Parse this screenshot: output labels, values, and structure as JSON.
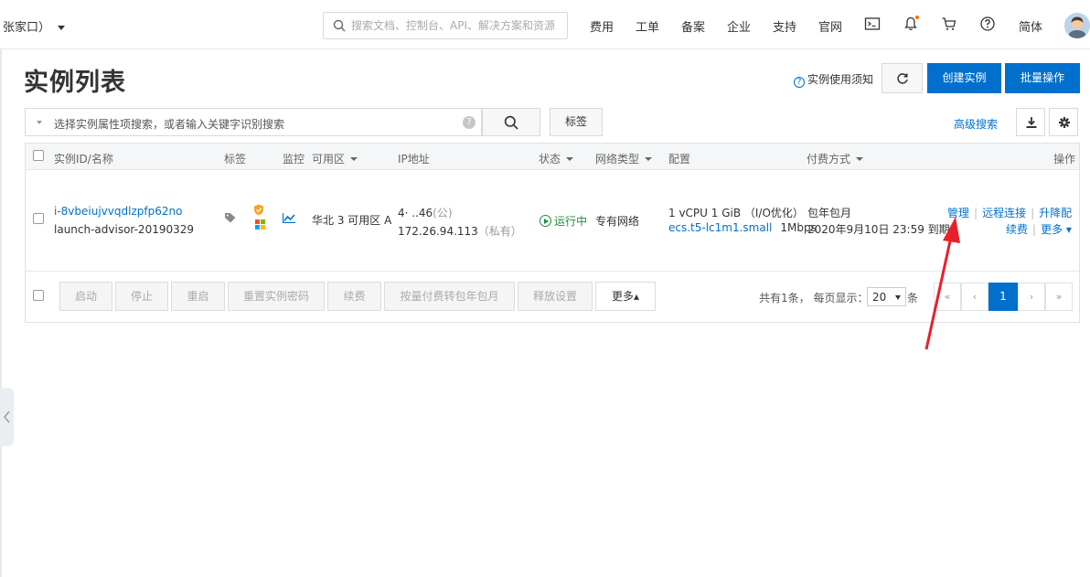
{
  "topbar": {
    "region": "张家口）",
    "search_placeholder": "搜索文档、控制台、API、解决方案和资源",
    "nav": [
      "费用",
      "工单",
      "备案",
      "企业",
      "支持",
      "官网"
    ],
    "lang": "简体"
  },
  "header": {
    "title": "实例列表",
    "notice": "实例使用须知",
    "create_label": "创建实例",
    "batch_label": "批量操作"
  },
  "filter": {
    "placeholder": "选择实例属性项搜索，或者输入关键字识别搜索",
    "tag_label": "标签",
    "advanced_label": "高级搜索"
  },
  "table": {
    "columns": {
      "id_name": "实例ID/名称",
      "tags": "标签",
      "monitor": "监控",
      "zone": "可用区",
      "ip": "IP地址",
      "status": "状态",
      "network": "网络类型",
      "config": "配置",
      "billing": "付费方式",
      "actions": "操作"
    },
    "row": {
      "instance_id": "i-8vbeiujvvqdlzpfp62no",
      "instance_name": "launch-advisor-20190329",
      "zone": "华北 3 可用区 A",
      "public_ip": "4·    ..46",
      "public_suffix": "(公)",
      "private_ip": "172.26.94.113",
      "private_suffix": "（私有）",
      "status": "运行中",
      "network": "专有网络",
      "config_line1": "1 vCPU 1 GiB （I/O优化）",
      "instance_type": "ecs.t5-lc1m1.small",
      "bandwidth": "1Mbps",
      "billing_type": "包年包月",
      "expire": "2020年9月10日 23:59 到期",
      "action_manage": "管理",
      "action_remote": "远程连接",
      "action_resize": "升降配",
      "action_renew": "续费",
      "action_more": "更多"
    }
  },
  "footer": {
    "buttons": [
      "启动",
      "停止",
      "重启",
      "重置实例密码",
      "续费",
      "按量付费转包年包月",
      "释放设置"
    ],
    "more_label": "更多▴",
    "total_prefix": "共有1条，  每页显示：",
    "page_size": "20",
    "total_suffix": "条",
    "pager": {
      "first": "«",
      "prev": "‹",
      "current": "1",
      "next": "›",
      "last": "»"
    }
  },
  "colors": {
    "brand_blue": "#0070cc",
    "running_green": "#1e8e3e",
    "annotation_red": "#e8202a",
    "notification_dot": "#ff6a00"
  },
  "icons": [
    "search-icon",
    "terminal-icon",
    "bell-icon",
    "cart-icon",
    "help-icon",
    "refresh-icon",
    "download-icon",
    "gear-icon",
    "tag-icon",
    "security-shield-icon",
    "windows-icon",
    "monitor-chart-icon",
    "chevron-left-icon"
  ]
}
